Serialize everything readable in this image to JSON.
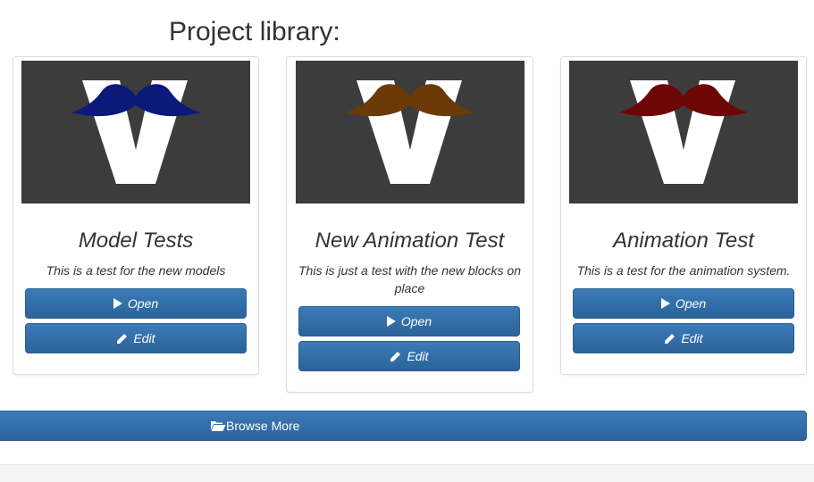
{
  "page": {
    "title": "Project library:"
  },
  "projects": [
    {
      "title": "Model Tests",
      "description": "This is a test for the new models",
      "open_label": "Open",
      "edit_label": "Edit",
      "mustache_color": "#0b1a7a"
    },
    {
      "title": "New Animation Test",
      "description": "This is just a test with the new blocks on place",
      "open_label": "Open",
      "edit_label": "Edit",
      "mustache_color": "#6b3a06"
    },
    {
      "title": "Animation Test",
      "description": "This is a test for the animation system.",
      "open_label": "Open",
      "edit_label": "Edit",
      "mustache_color": "#6e0606"
    }
  ],
  "browse": {
    "label": "Browse More",
    "icon": "folder-open-icon"
  },
  "colors": {
    "button": "#2f6aa3",
    "thumbnail_bg": "#3c3c3c",
    "logo": "#ffffff"
  }
}
